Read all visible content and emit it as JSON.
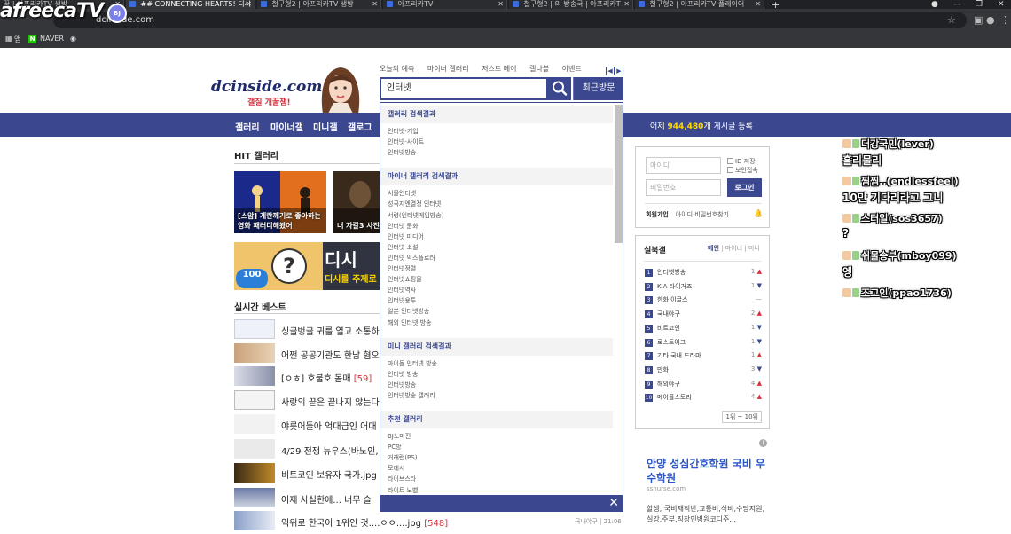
{
  "browser": {
    "tabs": [
      {
        "label": "꾹 | 아프리카TV 생방",
        "active": false
      },
      {
        "label": "## CONNECTING HEARTS! 디시",
        "active": true
      },
      {
        "label": "철구형2 | 아프리카TV 생방",
        "active": false
      },
      {
        "label": "아프리카TV",
        "active": false
      },
      {
        "label": "철구형2 | 의 방송국 | 아프리카T",
        "active": false
      },
      {
        "label": "철구형2 | 아프리카TV 플레이어",
        "active": false
      }
    ],
    "address": "dcinside.com",
    "bookmarks": [
      "앱",
      "NAVER"
    ],
    "new_tab": "+"
  },
  "overlay": {
    "logo": "afreecaTV",
    "badge": "BJ"
  },
  "header": {
    "topnav": [
      "오늘의 예측",
      "마이너 갤러리",
      "저스트 메이",
      "갤나블",
      "이벤트"
    ],
    "logo": "dcinside.com",
    "slogan": "갤질 개꿀잼!",
    "search_value": "인터넷",
    "recent_label": "최근방문"
  },
  "gnb": {
    "items": [
      "갤러리",
      "마이너갤",
      "미니갤",
      "갤로그"
    ],
    "count_prefix": "어제",
    "count_value": "944,480",
    "count_suffix": "개 게시글 등록"
  },
  "content": {
    "hit_title": "HIT 갤러리",
    "hit_cards": [
      {
        "caption": "[스압] 계란깨기로 좋아하는 영화 패러디해봤어"
      },
      {
        "caption": "내 자갈3 사진"
      }
    ],
    "banner": {
      "badge": "100",
      "big": "디시",
      "sub": "디시를 주제로"
    },
    "best_title": "실시간 베스트",
    "best": [
      {
        "text": "싱글벙글 귀를 열고 소통하",
        "count": ""
      },
      {
        "text": "어쩐 공공기관도 한남 혐오",
        "count": ""
      },
      {
        "text": "[ㅇㅎ] 호불호 몸매",
        "count": "[59]"
      },
      {
        "text": "사랑의 끝은 끝나지 않는다",
        "count": ""
      },
      {
        "text": "야릇어들아 억대급인 어대",
        "count": ""
      },
      {
        "text": "4/29 전쟁 뉴우스(바노인,",
        "count": ""
      },
      {
        "text": "비트코인 보유자 국가.jpg",
        "count": ""
      },
      {
        "text": "어제 사실한에... 너무 슬",
        "count": ""
      },
      {
        "text": "익위로 한국이 1위인 것....ㅇㅇ....jpg",
        "count": "[548]"
      }
    ],
    "last_meta": "국내야구 | 21:06"
  },
  "login": {
    "id_placeholder": "아이디",
    "pw_placeholder": "비밀번호",
    "save_id": "ID 저장",
    "secure": "보안접속",
    "login_btn": "로그인",
    "join": "회원가입",
    "find": "아이디·비밀번호찾기"
  },
  "realtime": {
    "title": "실북갤",
    "tabs": [
      "메인",
      "마이너",
      "미니"
    ],
    "items": [
      {
        "rank": "1",
        "name": "인터넷방송",
        "change": "1",
        "dir": "up"
      },
      {
        "rank": "2",
        "name": "KIA 타이거즈",
        "change": "1",
        "dir": "down"
      },
      {
        "rank": "3",
        "name": "한화 이글스",
        "change": "—",
        "dir": "same"
      },
      {
        "rank": "4",
        "name": "국내야구",
        "change": "2",
        "dir": "up"
      },
      {
        "rank": "5",
        "name": "비트코인",
        "change": "1",
        "dir": "down"
      },
      {
        "rank": "6",
        "name": "로스트아크",
        "change": "1",
        "dir": "down"
      },
      {
        "rank": "7",
        "name": "기타 국내 드라마",
        "change": "1",
        "dir": "up"
      },
      {
        "rank": "8",
        "name": "만화",
        "change": "3",
        "dir": "down"
      },
      {
        "rank": "9",
        "name": "해외야구",
        "change": "4",
        "dir": "up"
      },
      {
        "rank": "10",
        "name": "메이플스토리",
        "change": "4",
        "dir": "up"
      }
    ],
    "pagination": "1위 ~ 10위"
  },
  "ad": {
    "info": "i",
    "title": "안양 성심간호학원 국비 우수학원",
    "url": "ssnurse.com",
    "desc": "할생, 국비재직반,교통비,식비,수당지원,실강,주부,직장인병원코디주..."
  },
  "dropdown": {
    "sections": [
      {
        "title": "갤러리 검색결과",
        "items": [
          "인터넷-기업",
          "인터넷-사이트",
          "인터넷방송"
        ]
      },
      {
        "title": "마이너 갤러리 검색결과",
        "items": [
          "서울인터넷",
          "성국지엔결정 인터넷",
          "서령(인터넷게임방송)",
          "인터넷 문화",
          "인터넷 미디어",
          "인터넷 소설",
          "인터넷 익스플로러",
          "인터넷정렬",
          "인터넷쇼핑몰",
          "인터넷역사",
          "인터넷용투",
          "일본 인터넷방송",
          "해외 인터넷 방송"
        ]
      },
      {
        "title": "미니 갤러리 검색결과",
        "items": [
          "마이돌 인터넷 방송",
          "인터넷 방송",
          "인터넷방송",
          "인터넷방송 갤러리"
        ]
      },
      {
        "title": "추천 갤러리",
        "items": [
          "BJ노마진",
          "PC방",
          "거래런(PS)",
          "모에시",
          "라이브스타",
          "라이트 노벨"
        ]
      }
    ],
    "close": "✕"
  },
  "chat": [
    {
      "name": "더강국민(lever)",
      "message": "흘리물리"
    },
    {
      "name": "찜찜..(endlessfeel)",
      "message": "10만 기다리라고 그니"
    },
    {
      "name": "스터일(sos3657)",
      "message": "?"
    },
    {
      "name": "쉬물송부(mboy099)",
      "message": "엥"
    },
    {
      "name": "조고인(ppao1736)",
      "message": ""
    }
  ]
}
